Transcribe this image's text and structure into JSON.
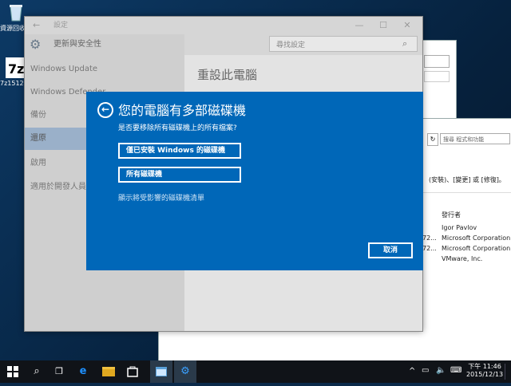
{
  "desktop": {
    "icons": [
      {
        "label": "資源回收筒"
      },
      {
        "label": "7z1512-..."
      }
    ]
  },
  "background_window": {
    "search_placeholder": "搜尋 程式和功能",
    "toolbar_text": "(安裝)、[變更] 或 [修復]。",
    "publisher_header": "發行者",
    "publishers": [
      "Igor Pavlov",
      "Microsoft Corporation",
      "Microsoft Corporation",
      "VMware, Inc."
    ],
    "trunc": [
      "72...",
      "72..."
    ]
  },
  "settings": {
    "window_title": "設定",
    "header": "更新與安全性",
    "search_placeholder": "尋找設定",
    "nav_items": [
      {
        "label": "Windows Update"
      },
      {
        "label": "Windows Defender"
      },
      {
        "label": "備份"
      },
      {
        "label": "還原",
        "selected": true
      },
      {
        "label": "啟用"
      },
      {
        "label": "適用於開發人員"
      }
    ],
    "page_title": "重設此電腦"
  },
  "dialog": {
    "title": "您的電腦有多部磁碟機",
    "question": "是否要移除所有磁碟機上的所有檔案?",
    "option1": "僅已安裝 Windows 的磁碟機",
    "option2": "所有磁碟機",
    "link": "顯示將受影響的磁碟機清單",
    "cancel": "取消"
  },
  "taskbar": {
    "time": "下午 11:46",
    "date": "2015/12/13"
  },
  "colors": {
    "dialog_blue": "#0067b8",
    "selected_nav": "#9ab0c9",
    "taskbar": "#101318"
  }
}
